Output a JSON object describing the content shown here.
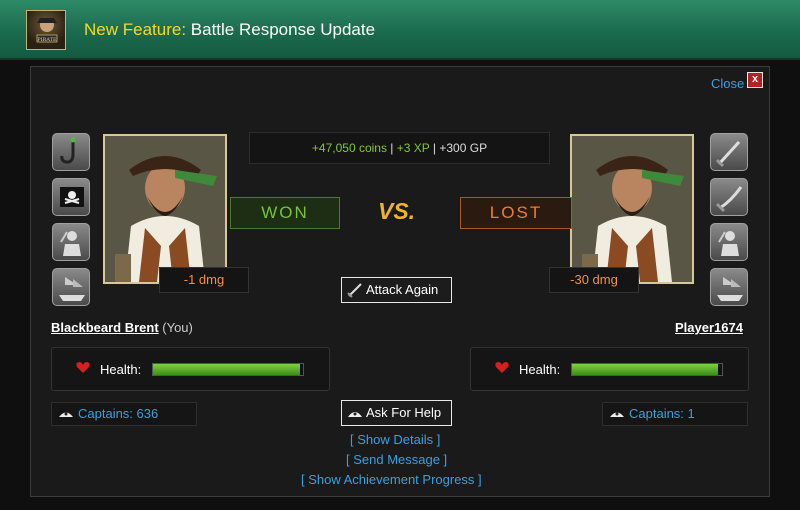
{
  "header": {
    "highlight": "New Feature:",
    "title": "Battle Response Update"
  },
  "dialog": {
    "close_label": "Close",
    "close_x": "x"
  },
  "reward": {
    "coins": "+47,050 coins",
    "sep1": " | ",
    "xp": "+3 XP",
    "sep2": " | ",
    "gp": "+300 GP"
  },
  "result": {
    "left": "WON",
    "vs": "VS.",
    "right": "LOST"
  },
  "player": {
    "name": "Blackbeard Brent",
    "suffix": " (You)",
    "damage": "-1 dmg",
    "health_label": "Health:",
    "health_fraction": 0.98,
    "captains_label": "Captains:",
    "captains_value": "636"
  },
  "opponent": {
    "name": "Player1674",
    "damage": "-30 dmg",
    "health_label": "Health:",
    "health_fraction": 0.97,
    "captains_label": "Captains:",
    "captains_value": "1"
  },
  "actions": {
    "attack_again": "Attack Again",
    "ask_for_help": "Ask For Help",
    "show_details": "[ Show Details ]",
    "send_message": "[ Send Message ]",
    "show_achievement": "[ Show Achievement Progress ]"
  },
  "slots": {
    "left": [
      "hook-icon",
      "jolly-roger-flag-icon",
      "pirate-crew-icon",
      "ship-icon"
    ],
    "right": [
      "cutlass-icon",
      "sabre-icon",
      "pirate-crew-icon",
      "ship-icon"
    ]
  },
  "colors": {
    "accent_green": "#7fc93a",
    "accent_orange": "#ee7e36",
    "link_blue": "#3aa0e0",
    "highlight_yellow": "#f7d928"
  }
}
